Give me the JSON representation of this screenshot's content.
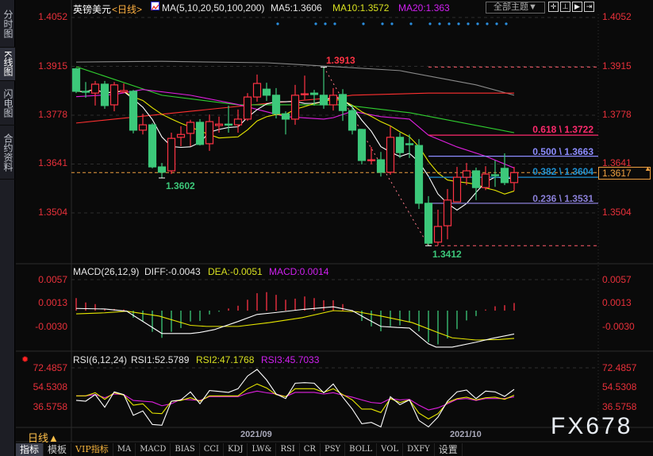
{
  "sidebar": {
    "items": [
      {
        "label": "分时图",
        "active": false
      },
      {
        "label": "K线图",
        "active": true
      },
      {
        "label": "闪电图",
        "active": false
      },
      {
        "label": "合约资料",
        "active": false
      }
    ]
  },
  "header": {
    "symbol": "英镑美元",
    "period_tag": "<日线>",
    "ma_label": "MA(5,10,20,50,100,200)",
    "ma5": "MA5:1.3606",
    "ma10": "MA10:1.3572",
    "ma20": "MA20:1.363",
    "theme_button": "全部主题▼"
  },
  "toolbar_icons": [
    "crosshair-icon",
    "zoom-fit-icon",
    "play-forward-icon",
    "jump-end-icon"
  ],
  "price_axis": [
    "1.4052",
    "1.3915",
    "1.3778",
    "1.3641",
    "1.3504"
  ],
  "current_price": "1.3617",
  "annotations": {
    "high": "1.3913",
    "low1": "1.3602",
    "low2": "1.3412"
  },
  "fib": [
    {
      "label": "0.618 \\ 1.3722",
      "ratio": 0.618,
      "price": 1.3722,
      "color": "#ff2a6d"
    },
    {
      "label": "0.500 \\ 1.3663",
      "ratio": 0.5,
      "price": 1.3663,
      "color": "#8c8cff"
    },
    {
      "label": "0.382 \\ 1.3604",
      "ratio": 0.382,
      "price": 1.3604,
      "color": "#1e8fd0"
    },
    {
      "label": "0.236 \\ 1.3531",
      "ratio": 0.236,
      "price": 1.3531,
      "color": "#8a7fd8"
    }
  ],
  "macd": {
    "title": "MACD(26,12,9)",
    "diff": "DIFF:-0.0043",
    "dea": "DEA:-0.0051",
    "macd": "MACD:0.0014",
    "axis": [
      "0.0057",
      "0.0013",
      "-0.0030"
    ]
  },
  "rsi": {
    "title": "RSI(6,12,24)",
    "rsi1": "RSI1:52.5789",
    "rsi2": "RSI2:47.1768",
    "rsi3": "RSI3:45.7033",
    "axis": [
      "72.4857",
      "54.5308",
      "36.5758"
    ]
  },
  "dates": [
    "2021/09",
    "2021/10"
  ],
  "period_selector": "日线▲",
  "bottom_tabs": [
    "指标",
    "模板",
    "VIP指标",
    "MA",
    "MACD",
    "BIAS",
    "CCI",
    "KDJ",
    "LW&",
    "RSI",
    "CR",
    "PSY",
    "BOLL",
    "VOL",
    "DXFY",
    "设置"
  ],
  "watermark": "FX678",
  "colors": {
    "up": "#ff3344",
    "down": "#3cc87a",
    "axis": "#e8303a",
    "ma5": "#ffffff",
    "ma10": "#e8e800",
    "ma20": "#e020e0",
    "ma50": "#30d030",
    "ma100": "#ff3030",
    "ma200": "#8a8a8a"
  },
  "chart_data": {
    "type": "candlestick",
    "title": "英镑美元 日线",
    "ylim": [
      1.3412,
      1.4052
    ],
    "ohlc": [
      [
        1.3908,
        1.3911,
        1.384,
        1.3845
      ],
      [
        1.3845,
        1.3871,
        1.3827,
        1.3843
      ],
      [
        1.384,
        1.3874,
        1.3805,
        1.3865
      ],
      [
        1.3865,
        1.3874,
        1.3796,
        1.3805
      ],
      [
        1.3807,
        1.3871,
        1.3789,
        1.3863
      ],
      [
        1.3843,
        1.3867,
        1.384,
        1.3847
      ],
      [
        1.3845,
        1.3849,
        1.3727,
        1.3736
      ],
      [
        1.3736,
        1.3782,
        1.3724,
        1.3751
      ],
      [
        1.3751,
        1.3756,
        1.3629,
        1.3633
      ],
      [
        1.3633,
        1.3644,
        1.3602,
        1.3618
      ],
      [
        1.3622,
        1.3729,
        1.3613,
        1.3713
      ],
      [
        1.3716,
        1.3747,
        1.3691,
        1.3724
      ],
      [
        1.3727,
        1.3765,
        1.3691,
        1.3758
      ],
      [
        1.3758,
        1.3767,
        1.3693,
        1.3696
      ],
      [
        1.3698,
        1.378,
        1.3678,
        1.376
      ],
      [
        1.3749,
        1.3774,
        1.3729,
        1.3753
      ],
      [
        1.3753,
        1.3805,
        1.3729,
        1.3751
      ],
      [
        1.3751,
        1.3794,
        1.3729,
        1.3767
      ],
      [
        1.3767,
        1.384,
        1.3762,
        1.3829
      ],
      [
        1.3829,
        1.3892,
        1.3816,
        1.3867
      ],
      [
        1.3851,
        1.3869,
        1.3818,
        1.3834
      ],
      [
        1.3834,
        1.3854,
        1.3769,
        1.3782
      ],
      [
        1.3782,
        1.3789,
        1.3724,
        1.3767
      ],
      [
        1.3767,
        1.3863,
        1.3751,
        1.3834
      ],
      [
        1.3836,
        1.3889,
        1.3822,
        1.3838
      ],
      [
        1.384,
        1.3849,
        1.3805,
        1.3836
      ],
      [
        1.3834,
        1.3913,
        1.3796,
        1.3807
      ],
      [
        1.3807,
        1.3854,
        1.3791,
        1.3834
      ],
      [
        1.3836,
        1.3851,
        1.3762,
        1.3791
      ],
      [
        1.3791,
        1.3807,
        1.3724,
        1.3736
      ],
      [
        1.3738,
        1.374,
        1.364,
        1.3651
      ],
      [
        1.3651,
        1.3689,
        1.364,
        1.3653
      ],
      [
        1.3653,
        1.3675,
        1.3606,
        1.3618
      ],
      [
        1.3618,
        1.3747,
        1.3611,
        1.3716
      ],
      [
        1.3716,
        1.3729,
        1.3658,
        1.3673
      ],
      [
        1.3698,
        1.3724,
        1.3658,
        1.3696
      ],
      [
        1.3693,
        1.3711,
        1.3515,
        1.3531
      ],
      [
        1.3531,
        1.3551,
        1.3412,
        1.3419
      ],
      [
        1.3422,
        1.3513,
        1.3413,
        1.3466
      ],
      [
        1.3468,
        1.3571,
        1.343,
        1.354
      ],
      [
        1.3535,
        1.3633,
        1.3535,
        1.3604
      ],
      [
        1.3604,
        1.3644,
        1.3582,
        1.3622
      ],
      [
        1.3622,
        1.3631,
        1.354,
        1.3575
      ],
      [
        1.3575,
        1.3635,
        1.3568,
        1.3613
      ],
      [
        1.3611,
        1.3651,
        1.3577,
        1.3609
      ],
      [
        1.3629,
        1.3671,
        1.3582,
        1.3589
      ],
      [
        1.3589,
        1.3633,
        1.3566,
        1.3617
      ]
    ],
    "ma20": [
      [
        0,
        1.383
      ],
      [
        4,
        1.3836
      ],
      [
        7,
        1.385
      ],
      [
        12,
        1.3834
      ],
      [
        17,
        1.3808
      ],
      [
        22,
        1.3774
      ],
      [
        26,
        1.3767
      ],
      [
        27,
        1.3771
      ],
      [
        29,
        1.3789
      ],
      [
        32,
        1.3774
      ],
      [
        35,
        1.3767
      ],
      [
        37,
        1.3722
      ],
      [
        40,
        1.3689
      ],
      [
        43,
        1.3663
      ],
      [
        46,
        1.363
      ]
    ],
    "ma50": [
      [
        0,
        1.3914
      ],
      [
        9,
        1.3834
      ],
      [
        17,
        1.3807
      ],
      [
        28,
        1.3807
      ],
      [
        35,
        1.3785
      ],
      [
        46,
        1.3729
      ]
    ],
    "ma100": [
      [
        0,
        1.3756
      ],
      [
        12,
        1.3789
      ],
      [
        20,
        1.3811
      ],
      [
        27,
        1.3827
      ],
      [
        29,
        1.3834
      ],
      [
        37,
        1.384
      ],
      [
        46,
        1.384
      ]
    ],
    "ma200": [
      [
        0,
        1.3927
      ],
      [
        9,
        1.3929
      ],
      [
        20,
        1.3925
      ],
      [
        26,
        1.3916
      ],
      [
        34,
        1.3903
      ],
      [
        42,
        1.3863
      ],
      [
        46,
        1.3834
      ]
    ],
    "event_markers": [
      21,
      25,
      26,
      27,
      30,
      32,
      33,
      35,
      37,
      38,
      39,
      40,
      41,
      42,
      43,
      44,
      45
    ],
    "macd_hist": [
      0.0023,
      0.0015,
      0.0012,
      0.0003,
      0.0003,
      0.0002,
      -0.0013,
      -0.002,
      -0.0039,
      -0.005,
      -0.0039,
      -0.0032,
      -0.002,
      -0.0019,
      -0.0007,
      -0.0002,
      0.0004,
      0.0009,
      0.002,
      0.0032,
      0.0034,
      0.0029,
      0.002,
      0.0022,
      0.0026,
      0.0023,
      0.0019,
      0.0019,
      0.0012,
      0.0001,
      -0.0019,
      -0.0029,
      -0.0038,
      -0.0029,
      -0.0027,
      -0.0021,
      -0.0038,
      -0.0058,
      -0.0062,
      -0.0051,
      -0.0034,
      -0.0018,
      -0.001,
      0.0002,
      0.0008,
      0.001,
      0.0014
    ],
    "macd_diff": [
      [
        0,
        0.0004
      ],
      [
        3,
        0.0003
      ],
      [
        5.3,
        -0.0001
      ],
      [
        9,
        -0.0042
      ],
      [
        12,
        -0.0042
      ],
      [
        13,
        -0.004
      ],
      [
        14.5,
        -0.0035
      ],
      [
        17,
        -0.002
      ],
      [
        19,
        -0.0007
      ],
      [
        20.7,
        -0.0004
      ],
      [
        23.7,
        0.0002
      ],
      [
        27,
        0.0007
      ],
      [
        29,
        0
      ],
      [
        30.3,
        -0.0013
      ],
      [
        32,
        -0.0029
      ],
      [
        33.7,
        -0.0031
      ],
      [
        35,
        -0.0032
      ],
      [
        37,
        -0.0061
      ],
      [
        37.8,
        -0.0067
      ],
      [
        39.5,
        -0.0067
      ],
      [
        42,
        -0.0058
      ],
      [
        43.7,
        -0.0051
      ],
      [
        46,
        -0.0043
      ]
    ],
    "macd_dea": [
      [
        0,
        -0.0006
      ],
      [
        3,
        -0.0004
      ],
      [
        5.3,
        -0.0001
      ],
      [
        8.7,
        -0.001
      ],
      [
        12,
        -0.0027
      ],
      [
        13.7,
        -0.0029
      ],
      [
        17,
        -0.0029
      ],
      [
        20.3,
        -0.0022
      ],
      [
        23.7,
        -0.0013
      ],
      [
        27,
        0
      ],
      [
        29.5,
        -0.0002
      ],
      [
        32,
        -0.001
      ],
      [
        35.3,
        -0.0022
      ],
      [
        37.8,
        -0.0039
      ],
      [
        39.5,
        -0.005
      ],
      [
        42,
        -0.0054
      ],
      [
        44.5,
        -0.0053
      ],
      [
        46,
        -0.0051
      ]
    ],
    "rsi1": [
      42.5,
      41.7,
      47.8,
      36.1,
      50.3,
      47.8,
      28.7,
      32.7,
      20.2,
      19.5,
      41.7,
      42.9,
      50.3,
      39.3,
      51.5,
      50.7,
      49.8,
      53.2,
      64.9,
      71.0,
      61.3,
      48.3,
      44.1,
      58.3,
      58.8,
      58.3,
      49.5,
      57.6,
      45.4,
      34.4,
      20.9,
      22.1,
      18.0,
      45.9,
      38.5,
      42.9,
      23.9,
      18.0,
      27.0,
      41.7,
      50.3,
      52.0,
      44.1,
      51.0,
      50.3,
      46.1,
      52.6
    ],
    "rsi2": [
      46.6,
      46.6,
      49.5,
      43.4,
      49.5,
      47.3,
      38.0,
      39.3,
      30.7,
      30.2,
      41.7,
      42.4,
      44.9,
      41.7,
      46.6,
      46.6,
      46.6,
      46.6,
      53.2,
      57.6,
      53.9,
      47.8,
      45.9,
      53.2,
      53.2,
      53.2,
      49.8,
      53.2,
      47.8,
      42.9,
      34.4,
      34.4,
      31.2,
      44.1,
      40.5,
      42.9,
      30.7,
      25.3,
      30.2,
      40.5,
      44.1,
      45.4,
      42.9,
      44.9,
      45.4,
      43.4,
      47.2
    ],
    "rsi3": [
      46.6,
      46.6,
      47.8,
      44.9,
      48.3,
      47.8,
      42.4,
      41.7,
      41.0,
      37.5,
      39.3,
      43.4,
      43.0,
      42.4,
      45.9,
      45.9,
      45.9,
      45.9,
      49.0,
      51.0,
      49.5,
      48.3,
      45.9,
      49.8,
      49.8,
      49.8,
      48.3,
      49.5,
      47.3,
      45.4,
      42.9,
      40.5,
      39.7,
      44.1,
      42.9,
      43.4,
      38.0,
      33.6,
      35.6,
      39.3,
      43.4,
      44.1,
      42.4,
      44.1,
      44.1,
      44.1,
      45.7
    ]
  }
}
